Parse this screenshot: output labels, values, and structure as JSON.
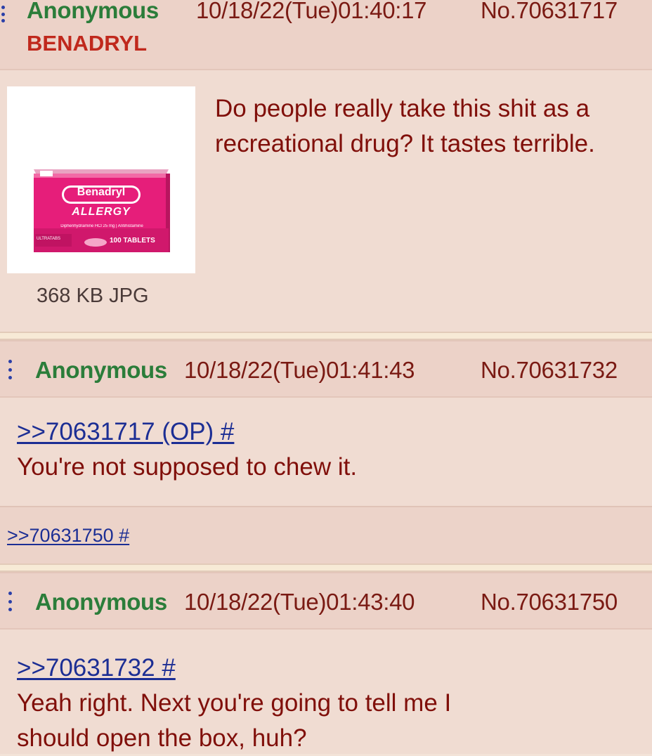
{
  "posts": [
    {
      "name": "Anonymous",
      "datetime": "10/18/22(Tue)01:40:17",
      "post_no": "No.70631717",
      "subject": "BENADRYL",
      "comment": "Do people really take this shit as a recreational drug? It tastes terrible.",
      "file": {
        "info": "368 KB JPG",
        "box_brand": "Benadryl",
        "box_line": "ALLERGY",
        "box_ingredient": "Diphenhydramine HCl 25 mg | Antihistamine",
        "box_badge": "ULTRATABS",
        "box_count": "100 TABLETS"
      }
    },
    {
      "name": "Anonymous",
      "datetime": "10/18/22(Tue)01:41:43",
      "post_no": "No.70631732",
      "quote": ">>70631717 (OP) #",
      "comment": "You're not supposed to chew it.",
      "backlink": ">>70631750 #"
    },
    {
      "name": "Anonymous",
      "datetime": "10/18/22(Tue)01:43:40",
      "post_no": "No.70631750",
      "quote": ">>70631732 #",
      "comment_line1": "Yeah right. Next you're going to tell me I",
      "comment_line2": "should open the box, huh?"
    }
  ],
  "colors": {
    "name": "#2b7d3a",
    "subject": "#c0281c",
    "text": "#800f0a",
    "link": "#1c2e94",
    "post_bg": "#f0dcd2",
    "header_bg": "#ecd2c8"
  }
}
